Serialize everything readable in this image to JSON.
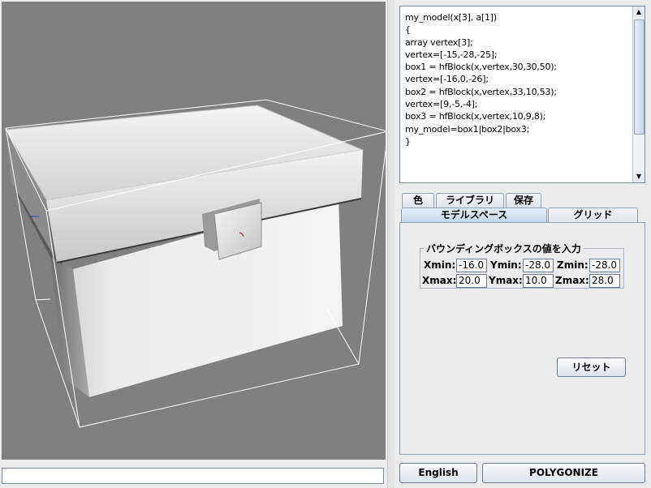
{
  "editor": {
    "code": "my_model(x[3], a[1])\n{\narray vertex[3];\nvertex=[-15,-28,-25];\nbox1 = hfBlock(x,vertex,30,30,50);\nvertex=[-16,0,-26];\nbox2 = hfBlock(x,vertex,33,10,53);\nvertex=[9,-5,-4];\nbox3 = hfBlock(x,vertex,10,9,8);\nmy_model=box1|box2|box3;\n}",
    "scroll_up_glyph": "▲",
    "scroll_down_glyph": "▼"
  },
  "tabs_top": [
    {
      "label": "色"
    },
    {
      "label": "ライブラリ"
    },
    {
      "label": "保存"
    }
  ],
  "tabs_bottom": [
    {
      "label": "モデルスペース",
      "selected": true
    },
    {
      "label": "グリッド",
      "selected": false
    }
  ],
  "bbox": {
    "title": "バウンディングボックスの値を入力",
    "xmin_label": "Xmin:",
    "xmin": "-16.0",
    "ymin_label": "Ymin:",
    "ymin": "-28.0",
    "zmin_label": "Zmin:",
    "zmin": "-28.0",
    "xmax_label": "Xmax:",
    "xmax": "20.0",
    "ymax_label": "Ymax:",
    "ymax": "10.0",
    "zmax_label": "Zmax:",
    "zmax": "28.0"
  },
  "reset_label": "リセット",
  "english_label": "English",
  "polygonize_label": "POLYGONIZE",
  "status_text": "",
  "colors": {
    "viewport_bg": "#808080",
    "panel_bg": "#ececec",
    "tab_selected": "#c6d8ec"
  }
}
